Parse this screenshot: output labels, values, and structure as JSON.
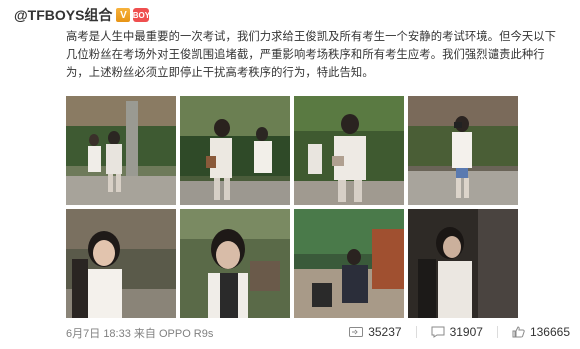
{
  "post": {
    "username": "@TFBOYS组合",
    "verified_badge": "V",
    "member_badge": "BOY",
    "text": "高考是人生中最重要的一次考试，我们力求给王俊凯及所有考生一个安静的考试环境。但今天以下几位粉丝在考场外对王俊凯围追堵截，严重影响考场秩序和所有考生应考。我们强烈谴责此种行为，上述粉丝必须立即停止干扰高考秩序的行为，特此告知。"
  },
  "photos_count": 8,
  "footer": {
    "date": "6月7日",
    "time": "18:33",
    "source_prefix": "来自",
    "device": "OPPO R9s"
  },
  "actions": {
    "reposts": "35237",
    "comments": "31907",
    "likes": "136665"
  },
  "colors": {
    "verified": "#f0a02a",
    "member": "#ef4f4f",
    "meta_gray": "#808080"
  }
}
